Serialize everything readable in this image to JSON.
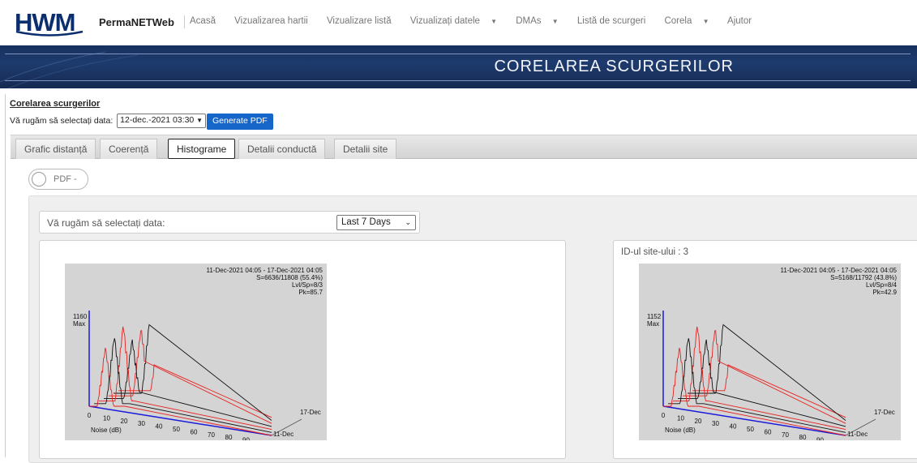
{
  "nav": {
    "logo": "HWM",
    "brand": "PermaNETWeb",
    "items": [
      {
        "label": "Acasă",
        "dropdown": false
      },
      {
        "label": "Vizualizarea hartii",
        "dropdown": false
      },
      {
        "label": "Vizualizare listă",
        "dropdown": false
      },
      {
        "label": "Vizualizați datele",
        "dropdown": true
      },
      {
        "label": "DMAs",
        "dropdown": true
      },
      {
        "label": "Listă de scurgeri",
        "dropdown": false
      },
      {
        "label": "Corela",
        "dropdown": true
      },
      {
        "label": "Ajutor",
        "dropdown": false
      }
    ]
  },
  "banner": {
    "title": "CORELAREA SCURGERILOR"
  },
  "page": {
    "subtitle": "Corelarea scurgerilor",
    "date_label": "Vă rugăm să selectați data:",
    "date_value": "12-dec.-2021 03:30",
    "generate_pdf": "Generate PDF"
  },
  "tabs": [
    {
      "label": "Grafic distanță",
      "active": false
    },
    {
      "label": "Coerență",
      "active": false
    },
    {
      "label": "Histograme",
      "active": true
    },
    {
      "label": "Detalii conductă",
      "active": false
    },
    {
      "label": "Detalii site",
      "active": false
    }
  ],
  "pdf_toggle": {
    "label": "PDF -"
  },
  "histogram_panel": {
    "select_label": "Vă rugăm să selectați data:",
    "period": "Last 7 Days"
  },
  "charts": [
    {
      "site_label": "",
      "header": [
        "11-Dec-2021 04:05 - 17-Dec-2021 04:05",
        "S=6636/11808 (55.4%)",
        "Lvl/Sp=8/3",
        "Pk=85.7"
      ],
      "max_value": "1160",
      "max_label": "Max",
      "x_ticks": [
        "0",
        "10",
        "20",
        "30",
        "40",
        "50",
        "60",
        "70",
        "80",
        "90"
      ],
      "x_label": "Noise (dB)",
      "date_start": "11-Dec",
      "date_end": "17-Dec"
    },
    {
      "site_label": "ID-ul site-ului : 3",
      "header": [
        "11-Dec-2021 04:05 - 17-Dec-2021 04:05",
        "S=5168/11792 (43.8%)",
        "Lvl/Sp=8/4",
        "Pk=42.9"
      ],
      "max_value": "1152",
      "max_label": "Max",
      "x_ticks": [
        "0",
        "10",
        "20",
        "30",
        "40",
        "50",
        "60",
        "70",
        "80",
        "90"
      ],
      "x_label": "Noise (dB)",
      "date_start": "11-Dec",
      "date_end": "17-Dec"
    }
  ],
  "colors": {
    "banner": "#1e3b6e",
    "accent": "#1566c8",
    "trace_red": "#e8201e",
    "trace_black": "#111111",
    "axis_blue": "#1a1adb"
  }
}
